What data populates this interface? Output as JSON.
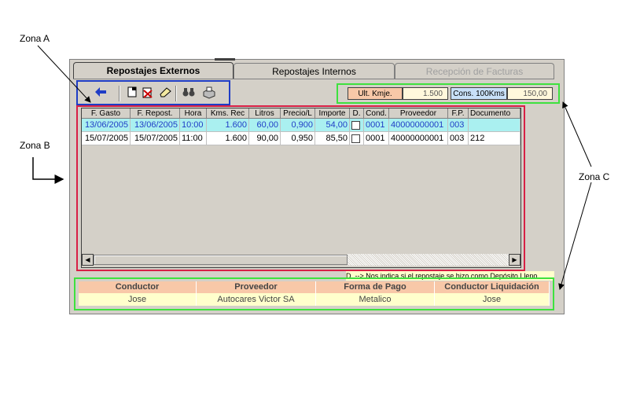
{
  "annotations": {
    "zona_a": "Zona A",
    "zona_b": "Zona B",
    "zona_c": "Zona C"
  },
  "tabs": [
    {
      "label": "Repostajes Externos",
      "state": "active"
    },
    {
      "label": "Repostajes Internos",
      "state": "normal"
    },
    {
      "label": "Recepción de Facturas",
      "state": "disabled"
    }
  ],
  "toolbar": {
    "icons": [
      "back-arrow-icon",
      "new-document-icon",
      "delete-icon",
      "eraser-icon",
      "binoculars-icon",
      "printer-icon"
    ]
  },
  "stats": {
    "ult_kmje_label": "Ult. Kmje.",
    "ult_kmje_value": "1.500",
    "cons_label": "Cons. 100Kms",
    "cons_value": "150,00"
  },
  "grid": {
    "columns": [
      "F. Gasto",
      "F. Repost.",
      "Hora",
      "Kms. Rec",
      "Litros",
      "Precio/L",
      "Importe",
      "D.",
      "Cond.",
      "Proveedor",
      "F.P.",
      "Documento"
    ],
    "rows": [
      {
        "f_gasto": "13/06/2005",
        "f_repost": "13/06/2005",
        "hora": "10:00",
        "kms": "1.600",
        "litros": "60,00",
        "precio": "0,900",
        "importe": "54,00",
        "deposito": false,
        "cond": "0001",
        "proveedor": "40000000001",
        "fp": "003",
        "documento": ""
      },
      {
        "f_gasto": "15/07/2005",
        "f_repost": "15/07/2005",
        "hora": "11:00",
        "kms": "1.600",
        "litros": "90,00",
        "precio": "0,950",
        "importe": "85,50",
        "deposito": false,
        "cond": "0001",
        "proveedor": "40000000001",
        "fp": "003",
        "documento": "212"
      }
    ]
  },
  "note": "D. --> Nos indica si el repostaje se hizo como Depósito Lleno",
  "summary": {
    "headers": [
      "Conductor",
      "Proveedor",
      "Forma de Pago",
      "Conductor Liquidación"
    ],
    "values": [
      "Jose",
      "Autocares Victor SA",
      "Metalico",
      "Jose"
    ]
  },
  "colors": {
    "zone_a": "#1f3dc6",
    "zone_b": "#d81f45",
    "zone_c": "#3ee13e",
    "selected_row": "#aaf0f0",
    "summary_header": "#f8c8a8",
    "summary_value": "#ffffcc"
  }
}
